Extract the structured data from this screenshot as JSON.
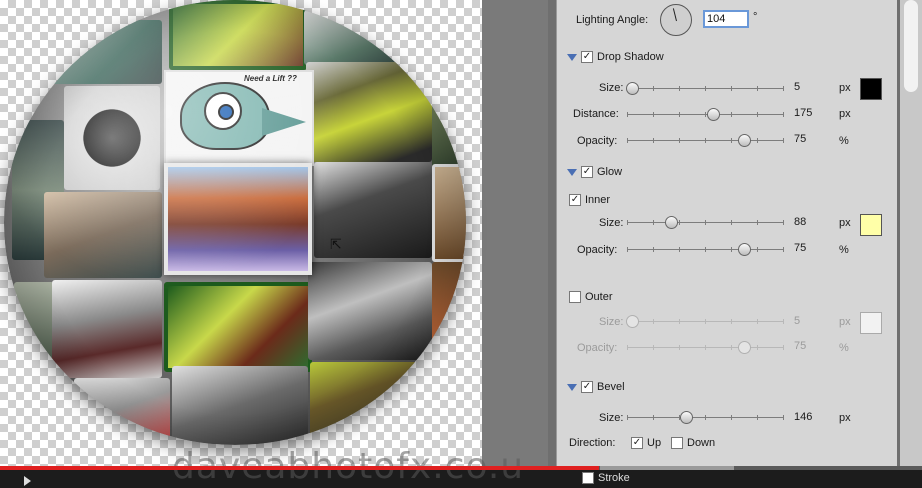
{
  "canvas": {
    "bird_caption": "Need a Lift ??"
  },
  "panel": {
    "lighting_angle": {
      "label": "Lighting Angle:",
      "value": "104",
      "unit": "°"
    },
    "drop_shadow": {
      "title": "Drop Shadow",
      "size": {
        "label": "Size:",
        "value": "5",
        "unit": "px",
        "fraction": 0.03
      },
      "distance": {
        "label": "Distance:",
        "value": "175",
        "unit": "px",
        "fraction": 0.55
      },
      "opacity": {
        "label": "Opacity:",
        "value": "75",
        "unit": "%",
        "fraction": 0.75
      }
    },
    "glow": {
      "title": "Glow",
      "inner": {
        "label": "Inner",
        "size": {
          "label": "Size:",
          "value": "88",
          "unit": "px",
          "fraction": 0.28
        },
        "opacity": {
          "label": "Opacity:",
          "value": "75",
          "unit": "%",
          "fraction": 0.75
        }
      },
      "outer": {
        "label": "Outer",
        "size": {
          "label": "Size:",
          "value": "5",
          "unit": "px",
          "fraction": 0.03
        },
        "opacity": {
          "label": "Opacity:",
          "value": "75",
          "unit": "%",
          "fraction": 0.75
        }
      }
    },
    "bevel": {
      "title": "Bevel",
      "size": {
        "label": "Size:",
        "value": "146",
        "unit": "px",
        "fraction": 0.38
      },
      "direction": {
        "label": "Direction:",
        "up": "Up",
        "down": "Down"
      }
    },
    "stroke": {
      "title": "Stroke"
    }
  },
  "player": {
    "progress": 0.65,
    "watermark": "daveabhotofx.co.u"
  },
  "colors": {
    "drop_shadow_swatch": "#000000",
    "inner_glow_swatch": "#ffffa8",
    "outer_glow_swatch": "#f2f2f2",
    "progress": "#e02020",
    "accent": "#4a6fb4"
  }
}
